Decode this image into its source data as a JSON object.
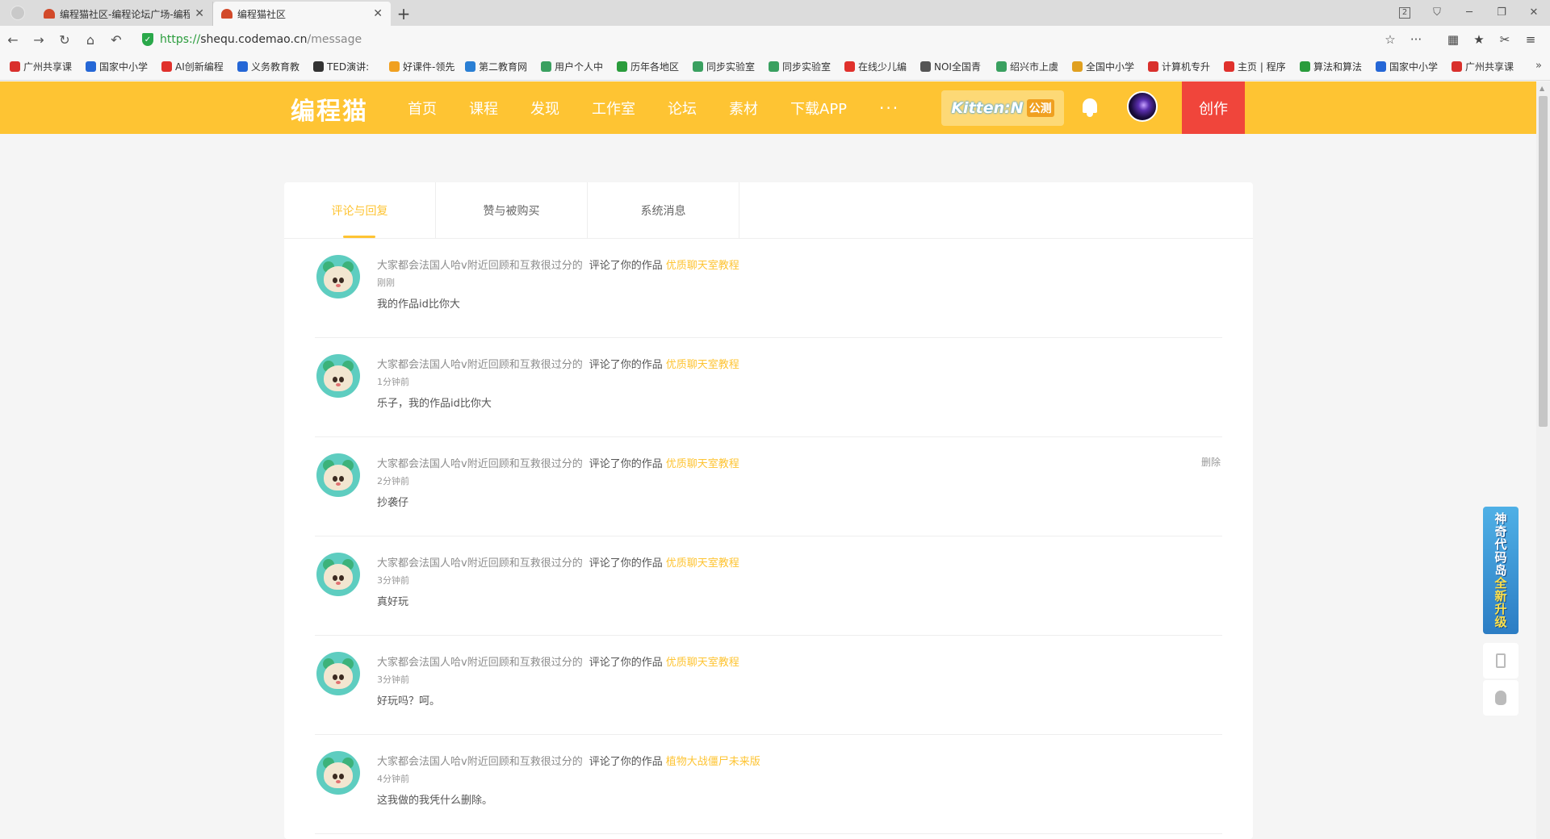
{
  "browser": {
    "tabs": [
      {
        "title": "编程猫社区-编程论坛广场-编程",
        "close": "✕"
      },
      {
        "title": "编程猫社区",
        "close": "✕"
      }
    ],
    "new_tab": "+",
    "tab_count": "2",
    "url_scheme": "https://",
    "url_host": "shequ.codemao.cn",
    "url_path": "/message",
    "bookmarks": [
      {
        "label": "广州共享课",
        "color": "#d9302c"
      },
      {
        "label": "国家中小学",
        "color": "#2567d6"
      },
      {
        "label": "AI创新编程",
        "color": "#e0312c"
      },
      {
        "label": "义务教育教",
        "color": "#2567d6"
      },
      {
        "label": "TED演讲:",
        "color": "#333333"
      },
      {
        "label": "好课件-领先",
        "color": "#f0a020"
      },
      {
        "label": "第二教育网",
        "color": "#2a7fd4"
      },
      {
        "label": "用户个人中",
        "color": "#3aa060"
      },
      {
        "label": "历年各地区",
        "color": "#2a9c3c"
      },
      {
        "label": "同步实验室",
        "color": "#3aa060"
      },
      {
        "label": "同步实验室",
        "color": "#3aa060"
      },
      {
        "label": "在线少儿编",
        "color": "#e0312c"
      },
      {
        "label": "NOI全国青",
        "color": "#555555"
      },
      {
        "label": "绍兴市上虞",
        "color": "#3aa060"
      },
      {
        "label": "全国中小学",
        "color": "#e0a020"
      },
      {
        "label": "计算机专升",
        "color": "#d9302c"
      },
      {
        "label": "主页 | 程序",
        "color": "#e0312c"
      },
      {
        "label": "算法和算法",
        "color": "#2a9c3c"
      },
      {
        "label": "国家中小学",
        "color": "#2567d6"
      },
      {
        "label": "广州共享课",
        "color": "#d9302c"
      }
    ],
    "bookmarks_more": "»"
  },
  "header": {
    "logo": "编程猫",
    "nav": [
      "首页",
      "课程",
      "发现",
      "工作室",
      "论坛",
      "素材",
      "下载APP"
    ],
    "more": "···",
    "kitten_label": "Kitten:N",
    "kitten_badge": "公测",
    "create_label": "创作"
  },
  "message_tabs": [
    "评论与回复",
    "赞与被购买",
    "系统消息"
  ],
  "messages": [
    {
      "user": "大家都会法国人哈v附近回顾和互救很过分的",
      "action": "评论了你的作品",
      "work": "优质聊天室教程",
      "time": "刚刚",
      "comment": "我的作品id比你大",
      "delete": ""
    },
    {
      "user": "大家都会法国人哈v附近回顾和互救很过分的",
      "action": "评论了你的作品",
      "work": "优质聊天室教程",
      "time": "1分钟前",
      "comment": "乐子，我的作品id比你大",
      "delete": ""
    },
    {
      "user": "大家都会法国人哈v附近回顾和互救很过分的",
      "action": "评论了你的作品",
      "work": "优质聊天室教程",
      "time": "2分钟前",
      "comment": "抄袭仔",
      "delete": "删除"
    },
    {
      "user": "大家都会法国人哈v附近回顾和互救很过分的",
      "action": "评论了你的作品",
      "work": "优质聊天室教程",
      "time": "3分钟前",
      "comment": "真好玩",
      "delete": ""
    },
    {
      "user": "大家都会法国人哈v附近回顾和互救很过分的",
      "action": "评论了你的作品",
      "work": "优质聊天室教程",
      "time": "3分钟前",
      "comment": "好玩吗？呵。",
      "delete": ""
    },
    {
      "user": "大家都会法国人哈v附近回顾和互救很过分的",
      "action": "评论了你的作品",
      "work": "植物大战僵尸未来版",
      "time": "4分钟前",
      "comment": "这我做的我凭什么删除。",
      "delete": ""
    }
  ],
  "promo": {
    "line1": "神奇代码岛",
    "line2": "全新升级"
  },
  "colors": {
    "brand": "#fec433",
    "create": "#f0453b",
    "link": "#fec433"
  }
}
